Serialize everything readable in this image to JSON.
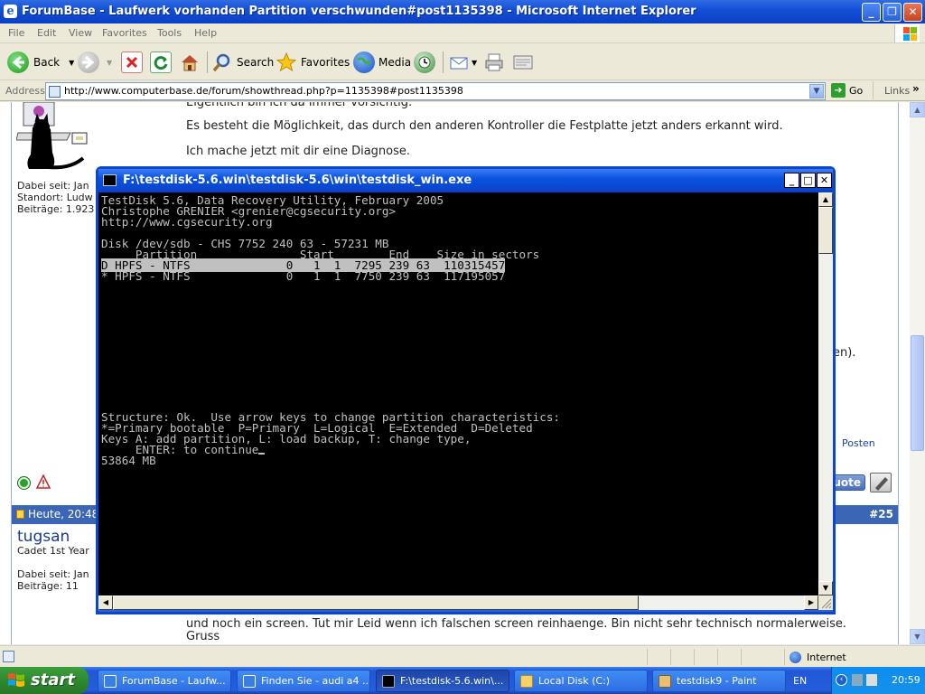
{
  "ie": {
    "title": "ForumBase - Laufwerk vorhanden Partition verschwunden#post1135398 - Microsoft Internet Explorer",
    "menu": [
      "File",
      "Edit",
      "View",
      "Favorites",
      "Tools",
      "Help"
    ],
    "toolbar": {
      "back": "Back",
      "search": "Search",
      "favorites": "Favorites",
      "media": "Media"
    },
    "address": {
      "label": "Address",
      "url": "http://www.computerbase.de/forum/showthread.php?p=1135398#post1135398",
      "go": "Go",
      "links": "Links"
    }
  },
  "page": {
    "line_top": "Eigentlich bin ich da immer vorsichtig.",
    "line1": "Es besteht die Möglichkeit, das durch den anderen Kontroller die Festplatte jetzt anders erkannt wird.",
    "line2": "Ich mache jetzt mit dir eine Diagnose.",
    "user1": {
      "dabei": "Dabei seit: Jan",
      "standort": "Standort: Ludw",
      "beitraege": "Beiträge: 1.923"
    },
    "partial_right": "en).",
    "posten_link": "Posten",
    "quote_button": "uote",
    "post25": {
      "date": "Heute, 20:48",
      "number": "#25",
      "username": "tugsan",
      "rank": "Cadet 1st Year",
      "dabei": "Dabei seit: Jan",
      "beitraege": "Beiträge: 11",
      "text1": "und noch ein screen. Tut mir Leid wenn ich falschen screen reinhaenge. Bin nicht sehr technisch normalerweise.",
      "text2": "Gruss"
    }
  },
  "status": {
    "zone": "Internet"
  },
  "console": {
    "title": "F:\\testdisk-5.6.win\\testdisk-5.6\\win\\testdisk_win.exe",
    "lines": {
      "l1": "TestDisk 5.6, Data Recovery Utility, February 2005",
      "l2": "Christophe GRENIER <grenier@cgsecurity.org>",
      "l3": "http://www.cgsecurity.org",
      "l4": "",
      "l5": "Disk /dev/sdb - CHS 7752 240 63 - 57231 MB",
      "l6": "     Partition               Start        End    Size in sectors",
      "row1": "D HPFS - NTFS              0   1  1  7295 239 63  110315457",
      "row2": "* HPFS - NTFS              0   1  1  7750 239 63  117195057",
      "s1": "Structure: Ok.  Use arrow keys to change partition characteristics:",
      "s2": "*=Primary bootable  P=Primary  L=Logical  E=Extended  D=Deleted",
      "s3": "Keys A: add partition, L: load backup, T: change type,",
      "s4": "     ENTER: to continue",
      "s5": "53864 MB"
    }
  },
  "taskbar": {
    "start": "start",
    "tasks": [
      "ForumBase - Laufw...",
      "Finden Sie - audi a4 ...",
      "F:\\testdisk-5.6.win\\...",
      "Local Disk (C:)",
      "testdisk9 - Paint"
    ],
    "lang": "EN",
    "clock": "20:59"
  },
  "colors": {
    "xp_blue": "#245edc",
    "forum_bar": "#3b65b5",
    "console_bg": "#000000",
    "console_fg": "#c0c0c0"
  }
}
